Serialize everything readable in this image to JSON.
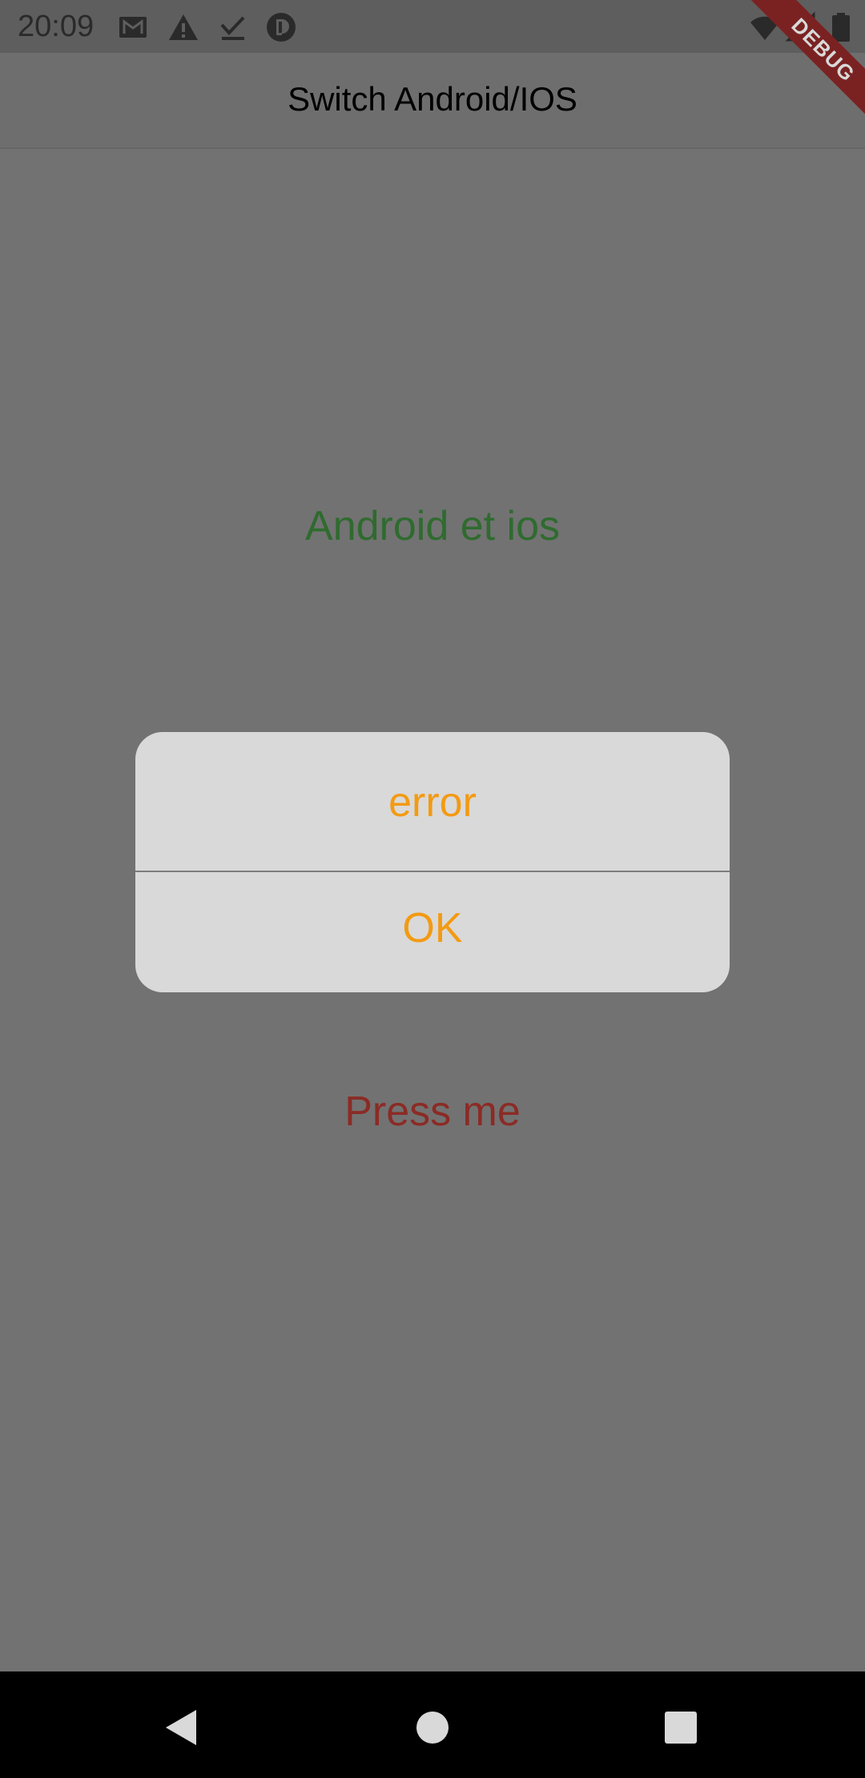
{
  "status_bar": {
    "time": "20:09",
    "icons": [
      "gmail-icon",
      "warning-icon",
      "download-done-icon",
      "app-badge-icon",
      "wifi-icon",
      "signal-icon",
      "battery-icon"
    ]
  },
  "app_bar": {
    "title": "Switch Android/IOS"
  },
  "debug_banner": {
    "label": "DEBUG"
  },
  "main": {
    "platform_text": "Android et ios",
    "press_button_label": "Press me"
  },
  "dialog": {
    "message": "error",
    "action_label": "OK"
  },
  "navigation_bar": {
    "buttons": [
      "back-icon",
      "home-icon",
      "recents-icon"
    ]
  },
  "colors": {
    "scrim_background": "#727272",
    "platform_text": "#2f6b2f",
    "press_text": "#8b2b25",
    "dialog_accent": "#f39a12",
    "dialog_background": "#d9d9d9",
    "debug_ribbon": "#7a2222"
  }
}
